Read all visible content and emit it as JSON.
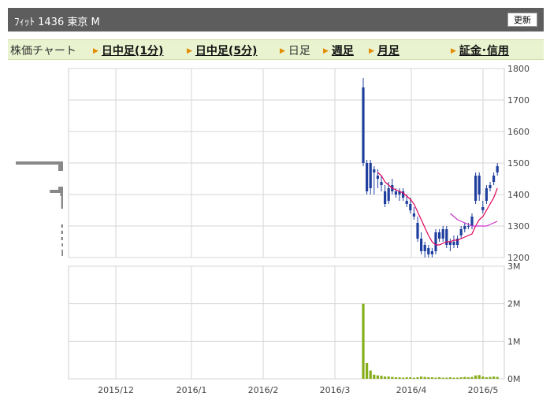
{
  "header": {
    "title": "ﾌｨｯﾄ  1436  東京 M",
    "refresh_label": "更新"
  },
  "nav": {
    "items": [
      {
        "label": "株価チャート",
        "type": "static"
      },
      {
        "label": "日中足(1分)",
        "type": "link"
      },
      {
        "label": "日中足(5分)",
        "type": "link"
      },
      {
        "label": "日足",
        "type": "active"
      },
      {
        "label": "週足",
        "type": "link"
      },
      {
        "label": "月足",
        "type": "link"
      },
      {
        "label": "証金･信用",
        "type": "link"
      }
    ]
  },
  "colors": {
    "candle_up": "#1f3f9e",
    "ma_short": "#e0005a",
    "ma_long": "#cc33cc",
    "volume": "#86ad1a",
    "volume_profile": "#888888"
  },
  "chart_data": [
    {
      "type": "candlestick",
      "title": "",
      "ylim": [
        1200,
        1800
      ],
      "y_ticks": [
        "1800",
        "1700",
        "1600",
        "1500",
        "1400",
        "1300",
        "1200"
      ],
      "x_ticks": [
        "2015/12",
        "2016/1",
        "2016/2",
        "2016/3",
        "2016/4",
        "2016/5"
      ],
      "candles": [
        {
          "o": 1500,
          "h": 1770,
          "l": 1490,
          "c": 1740
        },
        {
          "o": 1500,
          "h": 1510,
          "l": 1400,
          "c": 1410
        },
        {
          "o": 1420,
          "h": 1510,
          "l": 1400,
          "c": 1500
        },
        {
          "o": 1470,
          "h": 1490,
          "l": 1400,
          "c": 1480
        },
        {
          "o": 1450,
          "h": 1480,
          "l": 1420,
          "c": 1460
        },
        {
          "o": 1430,
          "h": 1460,
          "l": 1410,
          "c": 1440
        },
        {
          "o": 1410,
          "h": 1430,
          "l": 1360,
          "c": 1370
        },
        {
          "o": 1380,
          "h": 1440,
          "l": 1370,
          "c": 1420
        },
        {
          "o": 1430,
          "h": 1450,
          "l": 1400,
          "c": 1410
        },
        {
          "o": 1410,
          "h": 1420,
          "l": 1390,
          "c": 1400
        },
        {
          "o": 1400,
          "h": 1420,
          "l": 1380,
          "c": 1410
        },
        {
          "o": 1410,
          "h": 1420,
          "l": 1380,
          "c": 1390
        },
        {
          "o": 1380,
          "h": 1400,
          "l": 1360,
          "c": 1370
        },
        {
          "o": 1370,
          "h": 1390,
          "l": 1340,
          "c": 1350
        },
        {
          "o": 1340,
          "h": 1360,
          "l": 1320,
          "c": 1330
        },
        {
          "o": 1310,
          "h": 1330,
          "l": 1250,
          "c": 1260
        },
        {
          "o": 1260,
          "h": 1280,
          "l": 1210,
          "c": 1220
        },
        {
          "o": 1220,
          "h": 1250,
          "l": 1200,
          "c": 1240
        },
        {
          "o": 1230,
          "h": 1240,
          "l": 1200,
          "c": 1210
        },
        {
          "o": 1210,
          "h": 1230,
          "l": 1200,
          "c": 1220
        },
        {
          "o": 1220,
          "h": 1290,
          "l": 1210,
          "c": 1280
        },
        {
          "o": 1280,
          "h": 1290,
          "l": 1250,
          "c": 1260
        },
        {
          "o": 1260,
          "h": 1300,
          "l": 1250,
          "c": 1290
        },
        {
          "o": 1290,
          "h": 1300,
          "l": 1230,
          "c": 1240
        },
        {
          "o": 1240,
          "h": 1260,
          "l": 1220,
          "c": 1250
        },
        {
          "o": 1250,
          "h": 1270,
          "l": 1230,
          "c": 1240
        },
        {
          "o": 1240,
          "h": 1270,
          "l": 1230,
          "c": 1260
        },
        {
          "o": 1270,
          "h": 1300,
          "l": 1260,
          "c": 1290
        },
        {
          "o": 1300,
          "h": 1310,
          "l": 1280,
          "c": 1290
        },
        {
          "o": 1300,
          "h": 1310,
          "l": 1290,
          "c": 1300
        },
        {
          "o": 1300,
          "h": 1340,
          "l": 1290,
          "c": 1330
        },
        {
          "o": 1380,
          "h": 1470,
          "l": 1370,
          "c": 1460
        },
        {
          "o": 1460,
          "h": 1470,
          "l": 1380,
          "c": 1400
        },
        {
          "o": 1360,
          "h": 1380,
          "l": 1340,
          "c": 1350
        },
        {
          "o": 1380,
          "h": 1430,
          "l": 1370,
          "c": 1420
        },
        {
          "o": 1420,
          "h": 1440,
          "l": 1410,
          "c": 1430
        },
        {
          "o": 1440,
          "h": 1470,
          "l": 1430,
          "c": 1460
        },
        {
          "o": 1470,
          "h": 1500,
          "l": 1460,
          "c": 1490
        }
      ],
      "ma_short": [
        null,
        null,
        null,
        null,
        1470,
        1460,
        1440,
        1430,
        1420,
        1415,
        1410,
        1405,
        1395,
        1385,
        1370,
        1345,
        1320,
        1295,
        1270,
        1250,
        1240,
        1240,
        1245,
        1250,
        1250,
        1255,
        1255,
        1260,
        1265,
        1270,
        1275,
        1300,
        1320,
        1330,
        1350,
        1370,
        1390,
        1420
      ],
      "ma_long": [
        null,
        null,
        null,
        null,
        null,
        null,
        null,
        null,
        null,
        null,
        null,
        null,
        null,
        null,
        null,
        null,
        null,
        null,
        null,
        null,
        null,
        null,
        null,
        null,
        1340,
        1330,
        1320,
        1315,
        1310,
        1305,
        1300,
        1300,
        1300,
        1300,
        1300,
        1305,
        1310,
        1315
      ]
    },
    {
      "type": "bar",
      "title": "",
      "ylim": [
        0,
        3000000
      ],
      "y_ticks": [
        "3M",
        "2M",
        "1M",
        "0M"
      ],
      "x_ticks": [
        "2015/12",
        "2016/1",
        "2016/2",
        "2016/3",
        "2016/4",
        "2016/5"
      ],
      "values": [
        2000000,
        420000,
        220000,
        110000,
        90000,
        80000,
        60000,
        60000,
        50000,
        40000,
        40000,
        30000,
        40000,
        40000,
        30000,
        40000,
        60000,
        50000,
        40000,
        40000,
        30000,
        40000,
        30000,
        30000,
        40000,
        30000,
        30000,
        40000,
        50000,
        40000,
        50000,
        90000,
        100000,
        60000,
        40000,
        50000,
        60000,
        50000
      ]
    }
  ],
  "volume_profile": [
    {
      "price": 1500,
      "amount": 1.0
    },
    {
      "price": 1490,
      "amount": 0.1
    },
    {
      "price": 1480,
      "amount": 0.1
    },
    {
      "price": 1420,
      "amount": 0.1
    },
    {
      "price": 1410,
      "amount": 0.28
    },
    {
      "price": 1400,
      "amount": 0.06
    },
    {
      "price": 1390,
      "amount": 0.04
    },
    {
      "price": 1380,
      "amount": 0.04
    },
    {
      "price": 1370,
      "amount": 0.04
    },
    {
      "price": 1360,
      "amount": 0.04
    },
    {
      "price": 1300,
      "amount": 0.04
    },
    {
      "price": 1280,
      "amount": 0.04
    },
    {
      "price": 1260,
      "amount": 0.04
    },
    {
      "price": 1240,
      "amount": 0.03
    },
    {
      "price": 1220,
      "amount": 0.03
    },
    {
      "price": 1210,
      "amount": 0.03
    }
  ]
}
